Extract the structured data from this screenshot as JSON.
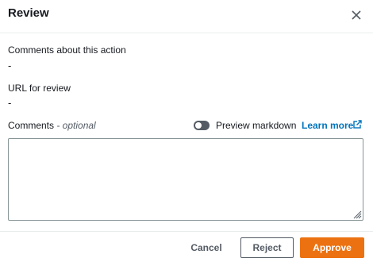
{
  "dialog": {
    "title": "Review",
    "close_icon": "close-icon"
  },
  "fields": {
    "comments_about_action": {
      "label": "Comments about this action",
      "value": "-"
    },
    "url_for_review": {
      "label": "URL for review",
      "value": "-"
    }
  },
  "comments": {
    "label": "Comments",
    "optional_suffix": " - optional",
    "value": "",
    "preview_toggle": {
      "label": "Preview markdown",
      "checked": false
    },
    "learn_more": "Learn more",
    "learn_more_icon": "external-link-icon"
  },
  "footer": {
    "cancel_label": "Cancel",
    "reject_label": "Reject",
    "approve_label": "Approve"
  },
  "colors": {
    "approve": "#ec7211",
    "link": "#0073bb",
    "border": "#879596"
  }
}
